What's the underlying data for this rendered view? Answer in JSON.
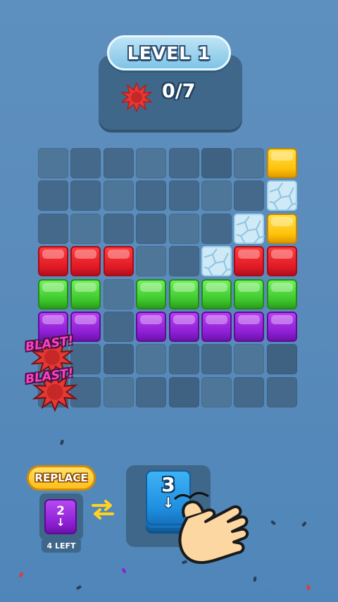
{
  "level": {
    "label": "LEVEL 1"
  },
  "goal": {
    "icon": "splat-icon",
    "count": "0/7",
    "color": "#e53935"
  },
  "board": {
    "cols": 8,
    "rows": 8,
    "cells": [
      [
        "e",
        "e",
        "e",
        "e",
        "e",
        "e",
        "e",
        "yellow"
      ],
      [
        "e",
        "e",
        "e",
        "e",
        "e",
        "e",
        "e",
        "ice"
      ],
      [
        "e",
        "e",
        "e",
        "e",
        "e",
        "e",
        "ice",
        "yellow"
      ],
      [
        "red",
        "red",
        "red",
        "e",
        "e",
        "ice",
        "red",
        "red"
      ],
      [
        "green",
        "green",
        "e",
        "green",
        "green",
        "green",
        "green",
        "green"
      ],
      [
        "purple",
        "purple",
        "e",
        "purple",
        "purple",
        "purple",
        "purple",
        "purple"
      ],
      [
        "e",
        "e",
        "e",
        "e",
        "e",
        "e",
        "e",
        "e"
      ],
      [
        "e",
        "e",
        "e",
        "e",
        "e",
        "e",
        "e",
        "e"
      ]
    ]
  },
  "blasts": [
    {
      "text": "BLAST!",
      "icon": "blast-splat-icon"
    },
    {
      "text": "BLAST!",
      "icon": "blast-splat-icon"
    }
  ],
  "replace": {
    "button_label": "REPLACE",
    "block_value": "2",
    "block_arrow": "↓",
    "remaining_label": "4 LEFT",
    "block_color": "#8d1fd4"
  },
  "swap": {
    "icon": "swap-arrows-icon"
  },
  "next": {
    "value": "3",
    "arrow": "↓",
    "color": "#1f8fe0"
  },
  "tutorial": {
    "icon": "pointing-hand-icon"
  },
  "colors": {
    "background": "#5a8bbb",
    "red": "#e01b26",
    "green": "#3ec82c",
    "purple": "#8d1fd4",
    "yellow": "#ffc20a",
    "ice": "#cfe9f7"
  }
}
